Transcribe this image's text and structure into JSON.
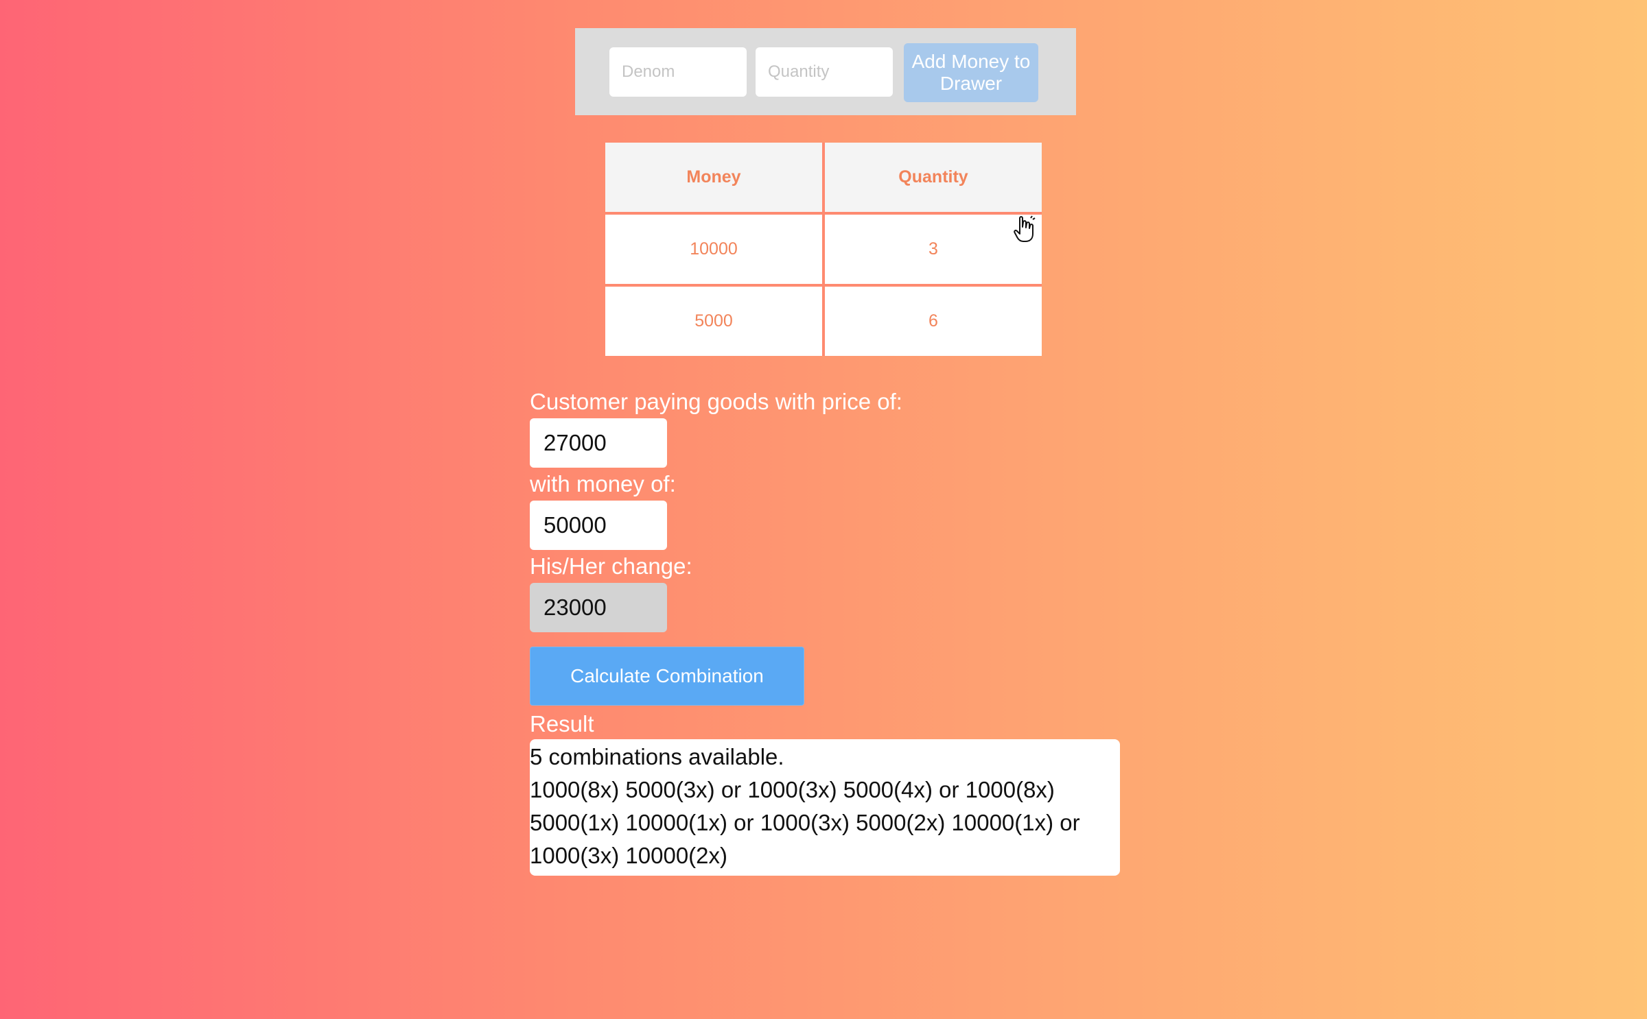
{
  "drawer_form": {
    "denom_placeholder": "Denom",
    "quantity_placeholder": "Quantity",
    "add_button_label": "Add Money to Drawer"
  },
  "money_table": {
    "headers": [
      "Money",
      "Quantity"
    ],
    "rows": [
      [
        "10000",
        "3"
      ],
      [
        "5000",
        "6"
      ]
    ]
  },
  "calculator": {
    "price_label": "Customer paying goods with price of:",
    "price_value": "27000",
    "money_label": "with money of:",
    "money_value": "50000",
    "change_label": "His/Her change:",
    "change_value": "23000",
    "calculate_button_label": "Calculate Combination"
  },
  "result": {
    "label": "Result",
    "summary": "5 combinations available.",
    "combinations": "1000(8x) 5000(3x) or 1000(3x) 5000(4x) or 1000(8x) 5000(1x) 10000(1x) or 1000(3x) 5000(2x) 10000(1x) or 1000(3x) 10000(2x)"
  },
  "colors": {
    "gradient_start": "#fe6575",
    "gradient_end": "#fec274",
    "table_text": "#f2845a",
    "button_primary": "#5aa9f4",
    "button_disabled": "#a8c9ec"
  },
  "icons": {
    "cursor": "hand-pointer-icon"
  }
}
